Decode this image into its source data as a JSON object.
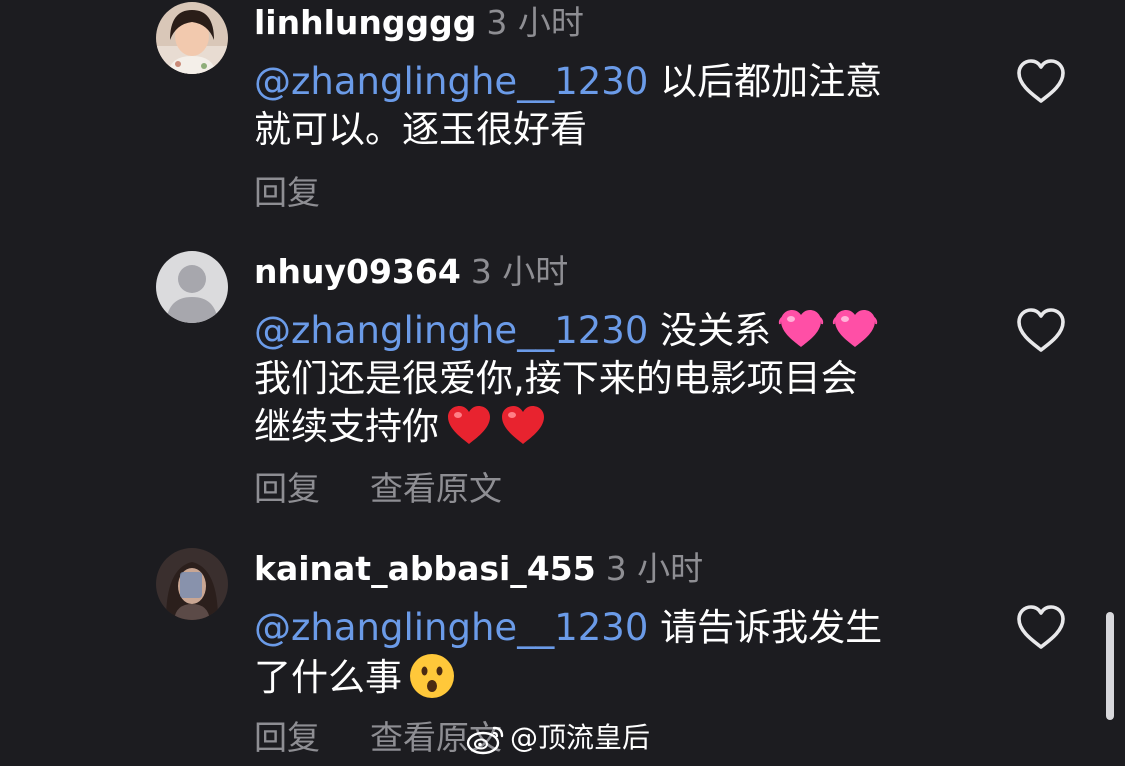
{
  "comments": [
    {
      "username": "linhlungggg",
      "time": "3 小时",
      "mention": "@zhanglinghe__1230",
      "text_line1": " 以后都加注意",
      "text_line2": "就可以。逐玉很好看",
      "reply": "回复"
    },
    {
      "username": "nhuy09364",
      "time": "3 小时",
      "mention": "@zhanglinghe__1230",
      "text_line1": " 没关系",
      "text_line2": "我们还是很爱你,接下来的电影项目会",
      "text_line3": "继续支持你",
      "reply": "回复",
      "see_original": "查看原文",
      "emojis_line1": [
        "pink-heart-emoji",
        "pink-heart-emoji"
      ],
      "emojis_line3": [
        "red-heart-emoji",
        "red-heart-emoji"
      ]
    },
    {
      "username": "kainat_abbasi_455",
      "time": "3 小时",
      "mention": "@zhanglinghe__1230",
      "text_line1": " 请告诉我发生",
      "text_line2": "了什么事",
      "reply": "回复",
      "see_original": "查看原文",
      "emojis_line2": [
        "surprised-face-emoji"
      ]
    }
  ],
  "watermark": "@顶流皇后",
  "colors": {
    "background": "#1c1c20",
    "mention": "#6b9be8",
    "secondary": "#8e8e93",
    "text": "#ffffff"
  }
}
